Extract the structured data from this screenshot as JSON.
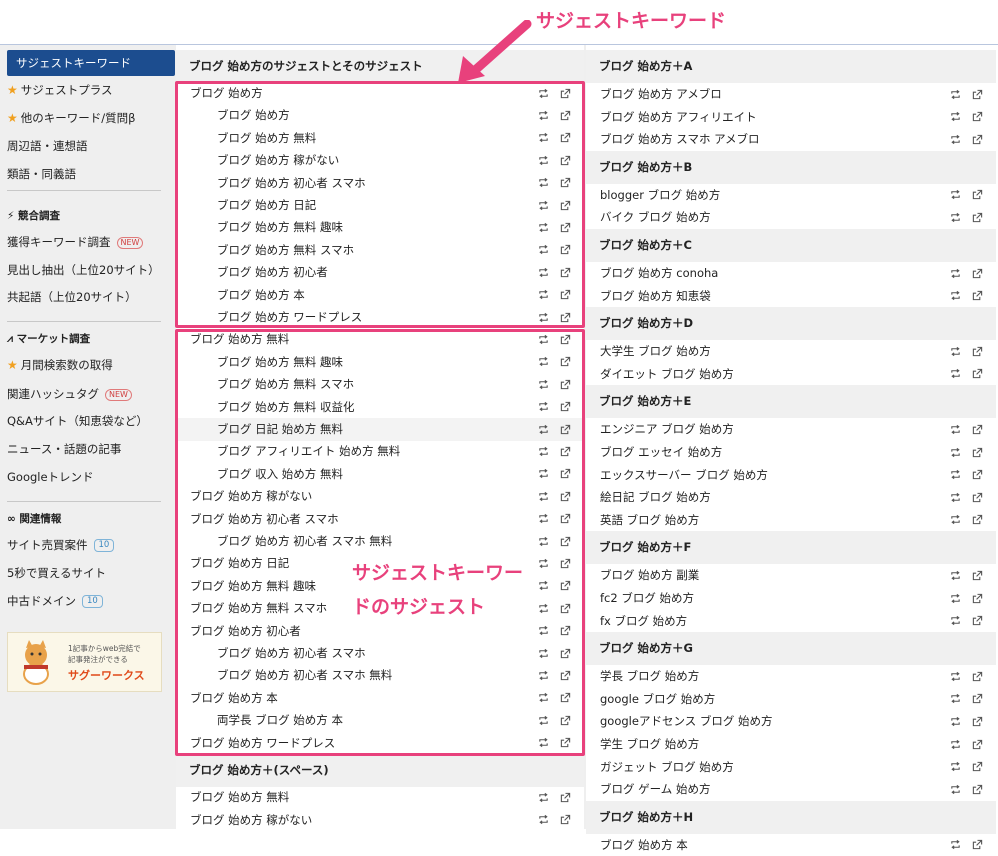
{
  "sidebar": {
    "active": "サジェストキーワード",
    "items": [
      {
        "label": "サジェストプラス",
        "star": true
      },
      {
        "label": "他のキーワード/質問β",
        "star": true
      },
      {
        "label": "周辺語・連想語",
        "star": false
      },
      {
        "label": "類語・同義語",
        "star": false
      }
    ],
    "section_competition": "競合調査",
    "competition_items": [
      {
        "label": "獲得キーワード調査",
        "badge": "NEW"
      },
      {
        "label": "見出し抽出（上位20サイト）"
      },
      {
        "label": "共起語（上位20サイト）"
      }
    ],
    "section_market": "マーケット調査",
    "market_items": [
      {
        "label": "月間検索数の取得",
        "star": true
      },
      {
        "label": "関連ハッシュタグ",
        "badge": "NEW"
      },
      {
        "label": "Q&Aサイト（知恵袋など）"
      },
      {
        "label": "ニュース・話題の記事"
      },
      {
        "label": "Googleトレンド"
      }
    ],
    "section_related": "関連情報",
    "related_items": [
      {
        "label": "サイト売買案件",
        "count": "10"
      },
      {
        "label": "5秒で買えるサイト"
      },
      {
        "label": "中古ドメイン",
        "count": "10"
      }
    ],
    "ad": {
      "line1": "1記事からweb完結で",
      "line2": "記事発注ができる",
      "brand": "サグーワークス"
    }
  },
  "middle": {
    "header": "ブログ 始め方のサジェストとそのサジェスト",
    "rows": [
      {
        "text": "ブログ 始め方",
        "indent": false
      },
      {
        "text": "ブログ 始め方",
        "indent": true
      },
      {
        "text": "ブログ 始め方 無料",
        "indent": true
      },
      {
        "text": "ブログ 始め方 稼がない",
        "indent": true
      },
      {
        "text": "ブログ 始め方 初心者 スマホ",
        "indent": true
      },
      {
        "text": "ブログ 始め方 日記",
        "indent": true
      },
      {
        "text": "ブログ 始め方 無料 趣味",
        "indent": true
      },
      {
        "text": "ブログ 始め方 無料 スマホ",
        "indent": true
      },
      {
        "text": "ブログ 始め方 初心者",
        "indent": true
      },
      {
        "text": "ブログ 始め方 本",
        "indent": true
      },
      {
        "text": "ブログ 始め方 ワードプレス",
        "indent": true
      },
      {
        "text": "ブログ 始め方 無料",
        "indent": false
      },
      {
        "text": "ブログ 始め方 無料 趣味",
        "indent": true
      },
      {
        "text": "ブログ 始め方 無料 スマホ",
        "indent": true
      },
      {
        "text": "ブログ 始め方 無料 収益化",
        "indent": true
      },
      {
        "text": "ブログ 日記 始め方 無料",
        "indent": true,
        "highlight": true
      },
      {
        "text": "ブログ アフィリエイト 始め方 無料",
        "indent": true
      },
      {
        "text": "ブログ 収入 始め方 無料",
        "indent": true
      },
      {
        "text": "ブログ 始め方 稼がない",
        "indent": false
      },
      {
        "text": "ブログ 始め方 初心者 スマホ",
        "indent": false
      },
      {
        "text": "ブログ 始め方 初心者 スマホ 無料",
        "indent": true
      },
      {
        "text": "ブログ 始め方 日記",
        "indent": false
      },
      {
        "text": "ブログ 始め方 無料 趣味",
        "indent": false
      },
      {
        "text": "ブログ 始め方 無料 スマホ",
        "indent": false
      },
      {
        "text": "ブログ 始め方 初心者",
        "indent": false
      },
      {
        "text": "ブログ 始め方 初心者 スマホ",
        "indent": true
      },
      {
        "text": "ブログ 始め方 初心者 スマホ 無料",
        "indent": true
      },
      {
        "text": "ブログ 始め方 本",
        "indent": false
      },
      {
        "text": "両学長 ブログ 始め方 本",
        "indent": true
      },
      {
        "text": "ブログ 始め方 ワードプレス",
        "indent": false
      }
    ],
    "space_header": "ブログ 始め方＋(スペース)",
    "space_rows": [
      "ブログ 始め方 無料",
      "ブログ 始め方 稼がない"
    ]
  },
  "right": {
    "groups": [
      {
        "header": "ブログ 始め方＋A",
        "rows": [
          "ブログ 始め方 アメブロ",
          "ブログ 始め方 アフィリエイト",
          "ブログ 始め方 スマホ アメブロ"
        ]
      },
      {
        "header": "ブログ 始め方＋B",
        "rows": [
          "blogger ブログ 始め方",
          "バイク ブログ 始め方"
        ]
      },
      {
        "header": "ブログ 始め方＋C",
        "rows": [
          "ブログ 始め方 conoha",
          "ブログ 始め方 知恵袋"
        ]
      },
      {
        "header": "ブログ 始め方＋D",
        "rows": [
          "大学生 ブログ 始め方",
          "ダイエット ブログ 始め方"
        ]
      },
      {
        "header": "ブログ 始め方＋E",
        "rows": [
          "エンジニア ブログ 始め方",
          "ブログ エッセイ 始め方",
          "エックスサーバー ブログ 始め方",
          "絵日記 ブログ 始め方",
          "英語 ブログ 始め方"
        ]
      },
      {
        "header": "ブログ 始め方＋F",
        "rows": [
          "ブログ 始め方 副業",
          "fc2 ブログ 始め方",
          "fx ブログ 始め方"
        ]
      },
      {
        "header": "ブログ 始め方＋G",
        "rows": [
          "学長 ブログ 始め方",
          "google ブログ 始め方",
          "googleアドセンス ブログ 始め方",
          "学生 ブログ 始め方",
          "ガジェット ブログ 始め方",
          "ブログ ゲーム 始め方"
        ]
      },
      {
        "header": "ブログ 始め方＋H",
        "rows": [
          "ブログ 始め方 本"
        ]
      }
    ]
  },
  "annotations": {
    "top": "サジェストキーワード",
    "mid_line1": "サジェストキーワー",
    "mid_line2": "ドのサジェスト",
    "color": "#e8417c"
  }
}
